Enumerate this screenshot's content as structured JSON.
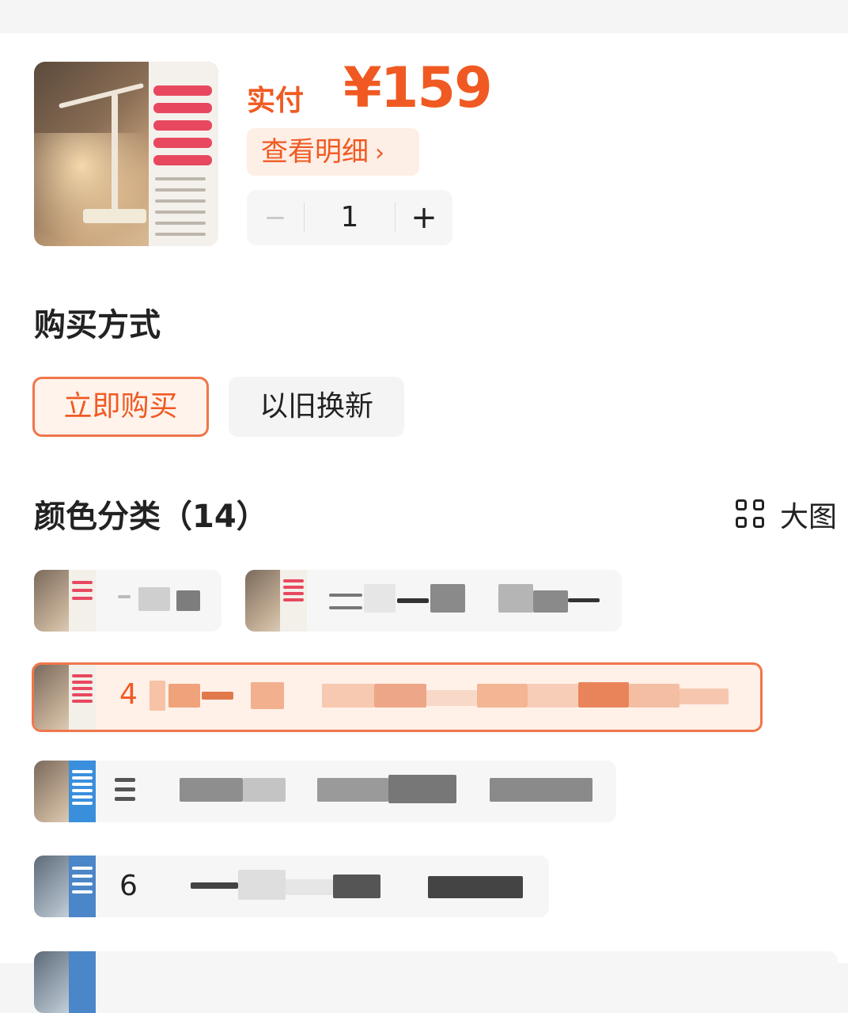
{
  "price": {
    "label": "实付",
    "amount": "¥159"
  },
  "detail_button": {
    "label": "查看明细",
    "chevron": "›"
  },
  "stepper": {
    "minus": "−",
    "quantity": "1",
    "plus": "+"
  },
  "purchase_method": {
    "title": "购买方式",
    "options": [
      {
        "label": "立即购买",
        "selected": true
      },
      {
        "label": "以旧换新",
        "selected": false
      }
    ]
  },
  "color_category": {
    "title": "颜色分类（14）",
    "big_view_label": "大图",
    "big_view_icon": "grid-icon",
    "variants": [
      {
        "label": "",
        "selected": false
      },
      {
        "label": "",
        "selected": false
      },
      {
        "label": "4",
        "selected": true
      },
      {
        "label": "",
        "selected": false
      },
      {
        "label": "6",
        "selected": false
      }
    ]
  },
  "colors": {
    "accent": "#f05a22",
    "accent_bg": "#fdeee6",
    "border_accent": "#f0764a"
  }
}
